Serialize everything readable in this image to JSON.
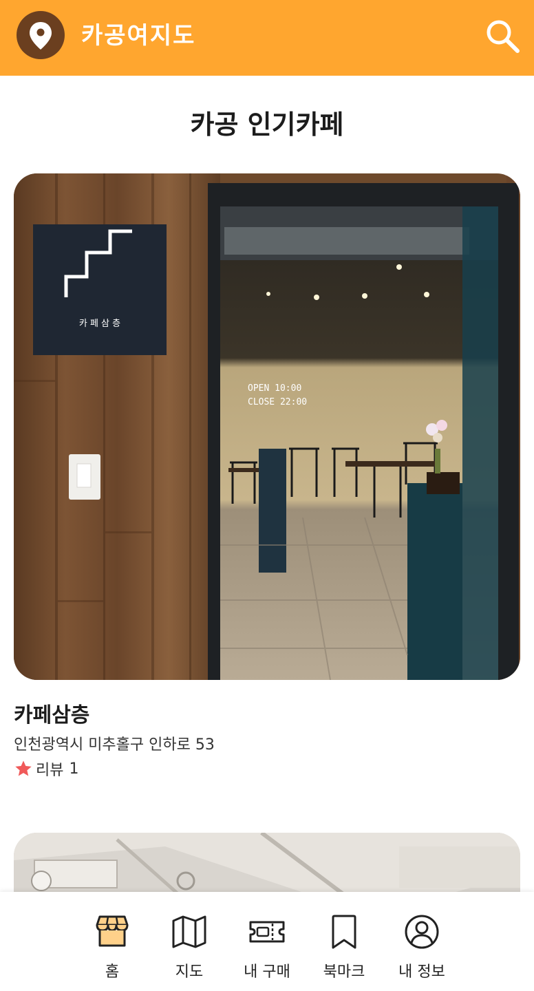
{
  "header": {
    "app_title": "카공여지도",
    "logo_icon": "location-pin-icon",
    "search_icon": "search-icon"
  },
  "section": {
    "title": "카공 인기카페"
  },
  "cafes": [
    {
      "name": "카페삼층",
      "address": "인천광역시 미추홀구 인하로 53",
      "review_label": "리뷰",
      "review_count": "1",
      "photo_sign_text": "카 페 삼 층",
      "photo_hours": [
        "OPEN   10:00",
        "CLOSE  22:00"
      ]
    }
  ],
  "bottom_nav": {
    "items": [
      {
        "label": "홈",
        "icon": "shop-icon",
        "active": true
      },
      {
        "label": "지도",
        "icon": "map-icon"
      },
      {
        "label": "내 구매",
        "icon": "ticket-icon"
      },
      {
        "label": "북마크",
        "icon": "bookmark-icon"
      },
      {
        "label": "내 정보",
        "icon": "user-profile-icon"
      }
    ]
  },
  "colors": {
    "brand": "#FFA62F",
    "logo_bg": "#6B3F1F",
    "star": "#F05A5A",
    "active_icon_fill": "#FFD18A"
  }
}
